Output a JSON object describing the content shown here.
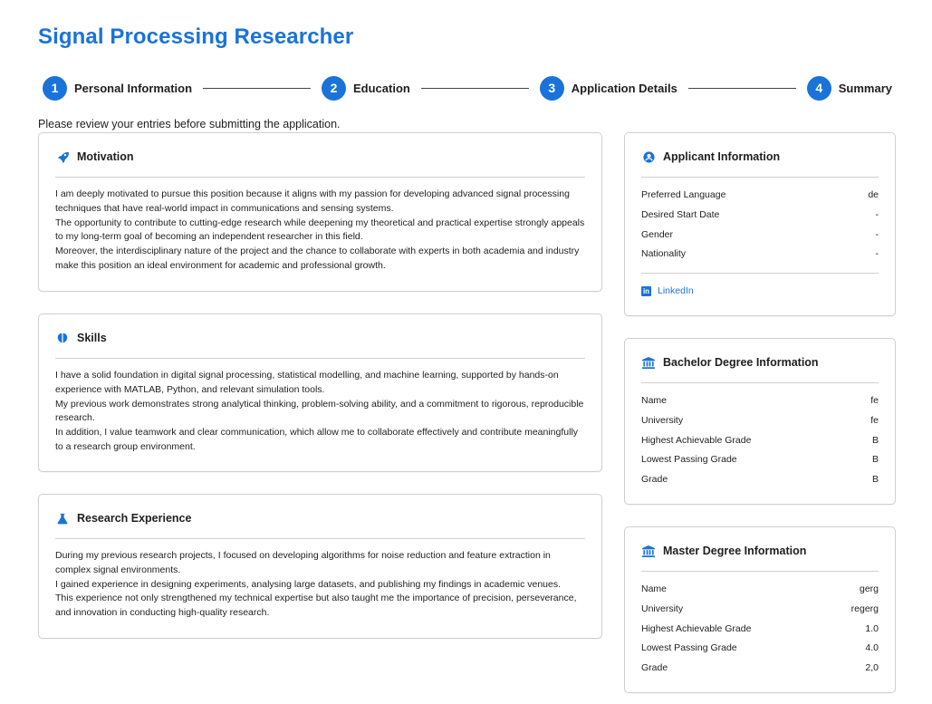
{
  "page": {
    "title": "Signal Processing Researcher",
    "intro": "Please review your entries before submitting the application."
  },
  "steps": [
    {
      "number": "1",
      "label": "Personal Information"
    },
    {
      "number": "2",
      "label": "Education"
    },
    {
      "number": "3",
      "label": "Application Details"
    },
    {
      "number": "4",
      "label": "Summary"
    }
  ],
  "motivation": {
    "title": "Motivation",
    "icon": "rocket-icon",
    "paragraphs": [
      "I am deeply motivated to pursue this position because it aligns with my passion for developing advanced signal processing techniques that have real-world impact in communications and sensing systems.",
      "The opportunity to contribute to cutting-edge research while deepening my theoretical and practical expertise strongly appeals to my long-term goal of becoming an independent researcher in this field.",
      "Moreover, the interdisciplinary nature of the project and the chance to collaborate with experts in both academia and industry make this position an ideal environment for academic and professional growth."
    ]
  },
  "skills": {
    "title": "Skills",
    "icon": "brain-icon",
    "paragraphs": [
      "I have a solid foundation in digital signal processing, statistical modelling, and machine learning, supported by hands-on experience with MATLAB, Python, and relevant simulation tools.",
      "My previous work demonstrates strong analytical thinking, problem-solving ability, and a commitment to rigorous, reproducible research.",
      "In addition, I value teamwork and clear communication, which allow me to collaborate effectively and contribute meaningfully to a research group environment."
    ]
  },
  "research": {
    "title": "Research Experience",
    "icon": "flask-icon",
    "paragraphs": [
      "During my previous research projects, I focused on developing algorithms for noise reduction and feature extraction in complex signal environments.",
      "I gained experience in designing experiments, analysing large datasets, and publishing my findings in academic venues.",
      "This experience not only strengthened my technical expertise but also taught me the importance of precision, perseverance, and innovation in conducting high-quality research."
    ]
  },
  "applicant": {
    "title": "Applicant Information",
    "icon": "user-circle-icon",
    "rows": [
      {
        "label": "Preferred Language",
        "value": "de"
      },
      {
        "label": "Desired Start Date",
        "value": "-"
      },
      {
        "label": "Gender",
        "value": "-"
      },
      {
        "label": "Nationality",
        "value": "-"
      }
    ],
    "linkedin_label": "LinkedIn"
  },
  "bachelor": {
    "title": "Bachelor Degree Information",
    "icon": "university-icon",
    "rows": [
      {
        "label": "Name",
        "value": "fe"
      },
      {
        "label": "University",
        "value": "fe"
      },
      {
        "label": "Highest Achievable Grade",
        "value": "B"
      },
      {
        "label": "Lowest Passing Grade",
        "value": "B"
      },
      {
        "label": "Grade",
        "value": "B"
      }
    ]
  },
  "master": {
    "title": "Master Degree Information",
    "icon": "university-icon",
    "rows": [
      {
        "label": "Name",
        "value": "gerg"
      },
      {
        "label": "University",
        "value": "regerg"
      },
      {
        "label": "Highest Achievable Grade",
        "value": "1.0"
      },
      {
        "label": "Lowest Passing Grade",
        "value": "4.0"
      },
      {
        "label": "Grade",
        "value": "2,0"
      }
    ]
  },
  "colors": {
    "accent": "#1a73d9",
    "border": "#cfcfcf",
    "text": "#1f1f1f"
  }
}
